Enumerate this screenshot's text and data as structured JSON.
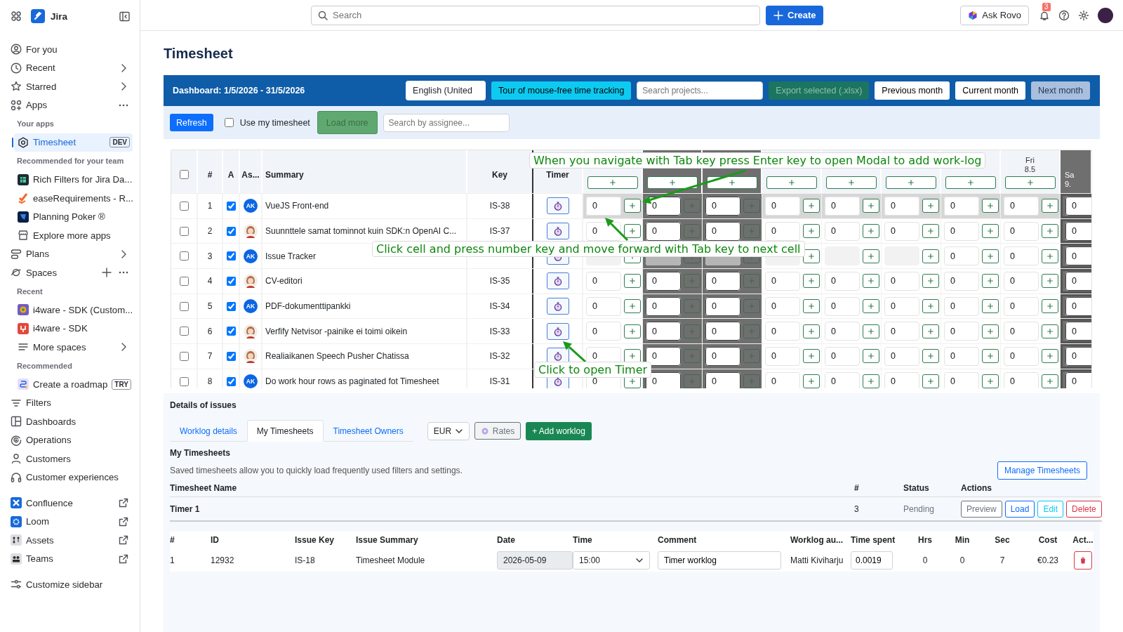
{
  "sidebar": {
    "product": "Jira",
    "items": [
      {
        "kind": "nav",
        "label": "For you",
        "selected": false
      },
      {
        "kind": "nav",
        "label": "Recent",
        "selected": false
      },
      {
        "kind": "nav",
        "label": "Starred",
        "selected": false
      },
      {
        "kind": "nav",
        "label": "Apps",
        "selected": false
      },
      {
        "kind": "heading",
        "label": "Your apps"
      },
      {
        "kind": "sub",
        "label": "Timesheet",
        "badge": "DEV",
        "selected": true
      },
      {
        "kind": "heading",
        "label": "Recommended for your team"
      },
      {
        "kind": "sub",
        "label": "Rich Filters for Jira Da...",
        "selected": false
      },
      {
        "kind": "sub",
        "label": "easeRequirements - R...",
        "selected": false
      },
      {
        "kind": "sub",
        "label": "Planning Poker ®",
        "selected": false
      },
      {
        "kind": "sub",
        "label": "Explore more apps",
        "selected": false
      },
      {
        "kind": "nav",
        "label": "Plans",
        "selected": false
      },
      {
        "kind": "nav",
        "label": "Spaces",
        "selected": false
      },
      {
        "kind": "heading",
        "label": "Recent"
      },
      {
        "kind": "sub",
        "label": "i4ware - SDK (Custom...",
        "selected": false
      },
      {
        "kind": "sub",
        "label": "i4ware - SDK",
        "selected": false
      },
      {
        "kind": "sub",
        "label": "More spaces",
        "selected": false
      },
      {
        "kind": "heading",
        "label": "Recommended"
      },
      {
        "kind": "sub",
        "label": "Create a roadmap",
        "badge": "TRY",
        "selected": false
      },
      {
        "kind": "nav",
        "label": "Filters",
        "selected": false
      },
      {
        "kind": "nav",
        "label": "Dashboards",
        "selected": false
      },
      {
        "kind": "nav",
        "label": "Operations",
        "selected": false
      },
      {
        "kind": "nav",
        "label": "Customers",
        "selected": false
      },
      {
        "kind": "nav",
        "label": "Customer experiences",
        "selected": false
      },
      {
        "kind": "nav",
        "label": "Confluence",
        "selected": false
      },
      {
        "kind": "nav",
        "label": "Loom",
        "selected": false
      },
      {
        "kind": "nav",
        "label": "Assets",
        "selected": false
      },
      {
        "kind": "nav",
        "label": "Teams",
        "selected": false
      },
      {
        "kind": "nav",
        "label": "Customize sidebar",
        "selected": false
      }
    ]
  },
  "topbar": {
    "search_placeholder": "Search",
    "create": "Create",
    "ask": "Ask Rovo",
    "notifications": "3"
  },
  "title": "Timesheet",
  "dashboard": {
    "title": "Dashboard: 1/5/2026 - 31/5/2026",
    "language": "English (United",
    "controls": [
      {
        "kind": "tour",
        "label": "Tour of mouse-free time tracking"
      },
      {
        "kind": "search",
        "placeholder": "Search projects..."
      },
      {
        "kind": "export",
        "label": "Export selected (.xlsx)",
        "disabled": true
      },
      {
        "kind": "month",
        "label": "Previous month",
        "selected": false
      },
      {
        "kind": "month",
        "label": "Current month",
        "selected": false
      },
      {
        "kind": "month",
        "label": "Next month",
        "selected": true
      }
    ]
  },
  "toolbar": {
    "refresh": "Refresh",
    "use_my_timesheet": {
      "label": "Use my timesheet",
      "checked": false
    },
    "load_more": {
      "label": "Load more",
      "disabled": true
    },
    "assignee_placeholder": "Search by assignee..."
  },
  "grid": {
    "columns": [
      "#",
      "A",
      "As...",
      "Summary",
      "Key",
      "Timer"
    ],
    "all_selected": false,
    "days": [
      {
        "weekend": false
      },
      {
        "weekend": true
      },
      {
        "weekend": true
      },
      {
        "weekend": false
      },
      {
        "weekend": false
      },
      {
        "weekend": false
      },
      {
        "weekend": false
      },
      {
        "weekend": false,
        "name": "Fri",
        "date": "8.5"
      },
      {
        "weekend": true,
        "name": "Sa",
        "date": "9."
      }
    ],
    "rows": [
      {
        "selected": false,
        "number": "1",
        "approved": true,
        "avatar": {
          "kind": "initials",
          "text": "AK"
        },
        "summary": "VueJS Front-end",
        "key": "IS-38",
        "focused": true,
        "hours": [
          "0",
          "0",
          "0",
          "0",
          "0",
          "0",
          "0",
          "0",
          "0"
        ]
      },
      {
        "selected": false,
        "number": "2",
        "approved": true,
        "summary": "Suunnttele samat tominnot kuin SDK:n OpenAI C...",
        "key": "IS-37",
        "focused": false,
        "hours": [
          "0",
          "0",
          "0",
          "0",
          "0",
          "0",
          "0",
          "0",
          "0"
        ]
      },
      {
        "selected": false,
        "number": "3",
        "approved": true,
        "avatar": {
          "kind": "initials",
          "text": "AK"
        },
        "summary": "Issue Tracker",
        "focused": false,
        "hours": [
          {
            "covered": true
          },
          {
            "covered": true
          },
          {
            "covered": true
          },
          {
            "covered": true
          },
          {
            "covered": true
          },
          {
            "covered": true
          },
          {
            "value": "0",
            "covered": false
          },
          {
            "value": "0",
            "covered": false
          },
          {
            "value": "0",
            "covered": false
          }
        ]
      },
      {
        "selected": false,
        "number": "4",
        "approved": true,
        "summary": "CV-editori",
        "key": "IS-35",
        "focused": false,
        "hours": [
          "0",
          "0",
          "0",
          "0",
          "0",
          "0",
          "0",
          "0",
          "0"
        ]
      },
      {
        "selected": false,
        "number": "5",
        "approved": true,
        "avatar": {
          "kind": "initials",
          "text": "AK"
        },
        "summary": "PDF-dokumenttipankki",
        "key": "IS-34",
        "focused": false,
        "hours": [
          "0",
          "0",
          "0",
          "0",
          "0",
          "0",
          "0",
          "0",
          "0"
        ]
      },
      {
        "selected": false,
        "number": "6",
        "approved": true,
        "summary": "Verfify Netvisor -painike ei toimi oikein",
        "key": "IS-33",
        "focused": false,
        "hours": [
          "0",
          "0",
          "0",
          "0",
          "0",
          "0",
          "0",
          "0",
          "0"
        ]
      },
      {
        "selected": false,
        "number": "7",
        "approved": true,
        "summary": "Realiaikanen Speech Pusher Chatissa",
        "key": "IS-32",
        "focused": false,
        "hours": [
          "0",
          "0",
          "0",
          "0",
          "0",
          "0",
          "0",
          "0",
          "0"
        ]
      },
      {
        "selected": false,
        "number": "8",
        "approved": true,
        "avatar": {
          "kind": "initials",
          "text": "AK"
        },
        "summary": "Do work hour rows as paginated fot Timesheet",
        "key": "IS-31",
        "focused": false,
        "hours": [
          "0",
          "0",
          "0",
          "0",
          "0",
          "0",
          "0",
          "0",
          "0"
        ]
      }
    ],
    "callouts": [
      {
        "text": "When you navigate with Tab key press Enter key to open Modal to add work-log"
      },
      {
        "text": "Click cell and press number key and move forward with Tab key to next cell"
      },
      {
        "text": "Click to open Timer"
      }
    ]
  },
  "details": {
    "title": "Details of issues",
    "tabs": [
      {
        "label": "Worklog details",
        "selected": false
      },
      {
        "label": "My Timesheets",
        "selected": true
      },
      {
        "label": "Timesheet Owners",
        "selected": false
      }
    ],
    "currency": "EUR",
    "rates": "Rates",
    "add_worklog": "+ Add worklog",
    "section_title": "My Timesheets",
    "description": "Saved timesheets allow you to quickly load frequently used filters and settings.",
    "manage": "Manage Timesheets",
    "saved": {
      "columns": [
        "Timesheet Name",
        "#",
        "Status",
        "Actions"
      ],
      "rows": [
        {
          "name": "Timer 1",
          "count": "3",
          "status": "Pending",
          "actions": [
            {
              "kind": "preview",
              "label": "Preview"
            },
            {
              "kind": "load",
              "label": "Load"
            },
            {
              "kind": "edit",
              "label": "Edit"
            },
            {
              "kind": "delete",
              "label": "Delete"
            }
          ]
        }
      ]
    },
    "worklogs": {
      "columns": [
        "#",
        "ID",
        "Issue Key",
        "Issue Summary",
        "Date",
        "Time",
        "Comment",
        "Worklog au...",
        "Time spent",
        "Hrs",
        "Min",
        "Sec",
        "Cost",
        "Act..."
      ],
      "rows": [
        {
          "number": "1",
          "id": "12932",
          "key": "IS-18",
          "summary": "Timesheet Module",
          "date": "2026-05-09",
          "time": "15:00",
          "comment": "Timer worklog",
          "author": "Matti Kiviharju",
          "time_spent": "0.0019",
          "hrs": "0",
          "min": "0",
          "sec": "7",
          "cost": "€0.23"
        }
      ]
    }
  }
}
